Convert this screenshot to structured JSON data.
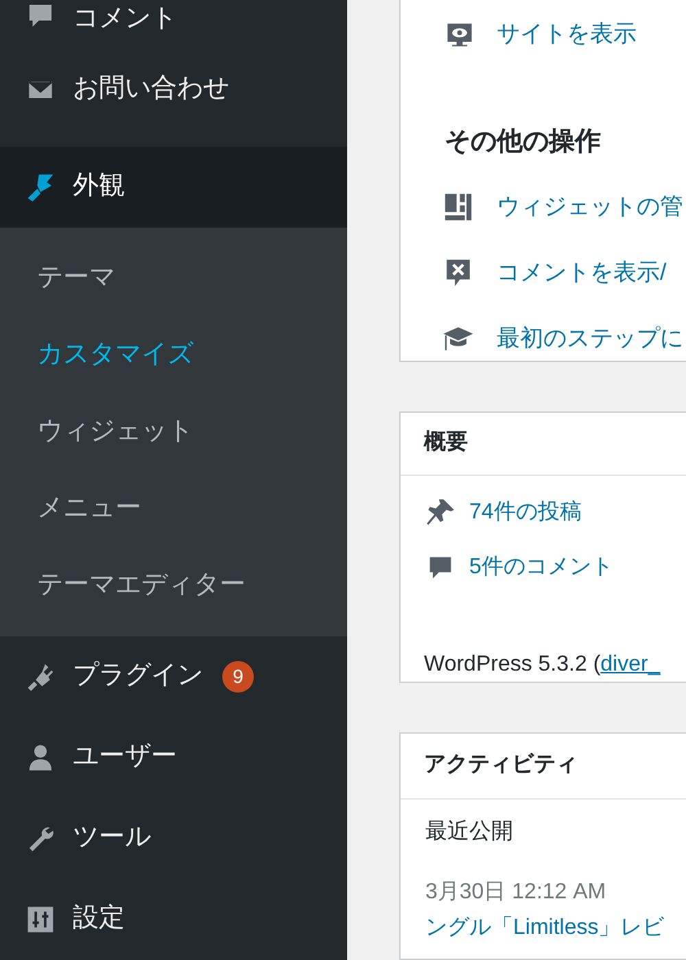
{
  "sidebar": {
    "items": [
      {
        "label": "コメント",
        "kind": "comment",
        "selected": false
      },
      {
        "label": "お問い合わせ",
        "kind": "mail",
        "selected": false
      },
      {
        "label": "外観",
        "kind": "brush",
        "selected": true,
        "children": [
          {
            "label": "テーマ",
            "selected": false
          },
          {
            "label": "カスタマイズ",
            "selected": true
          },
          {
            "label": "ウィジェット",
            "selected": false
          },
          {
            "label": "メニュー",
            "selected": false
          },
          {
            "label": "テーマエディター",
            "selected": false
          }
        ]
      },
      {
        "label": "プラグイン",
        "kind": "plugin",
        "selected": false,
        "badge": "9"
      },
      {
        "label": "ユーザー",
        "kind": "user",
        "selected": false
      },
      {
        "label": "ツール",
        "kind": "wrench",
        "selected": false
      },
      {
        "label": "設定",
        "kind": "sliders",
        "selected": false
      }
    ]
  },
  "welcome_card": {
    "links": [
      {
        "label": "サイトを表示",
        "kind": "view"
      }
    ],
    "more_actions_title": "その他の操作",
    "more_actions": [
      {
        "label": "ウィジェットの管",
        "kind": "widgets"
      },
      {
        "label": "コメントを表示/",
        "kind": "comment-x"
      },
      {
        "label": "最初のステップに",
        "kind": "cap"
      }
    ]
  },
  "overview_card": {
    "title": "概要",
    "items": [
      {
        "label": "74件の投稿",
        "kind": "pin"
      },
      {
        "label": "5件のコメント",
        "kind": "comment"
      }
    ],
    "version_text": "WordPress 5.3.2 (",
    "theme_link": "diver_"
  },
  "activity_card": {
    "title": "アクティビティ",
    "section": "最近公開",
    "date": "3月30日 12:12 AM",
    "post_link": "ングル「Limitless」レビ"
  }
}
